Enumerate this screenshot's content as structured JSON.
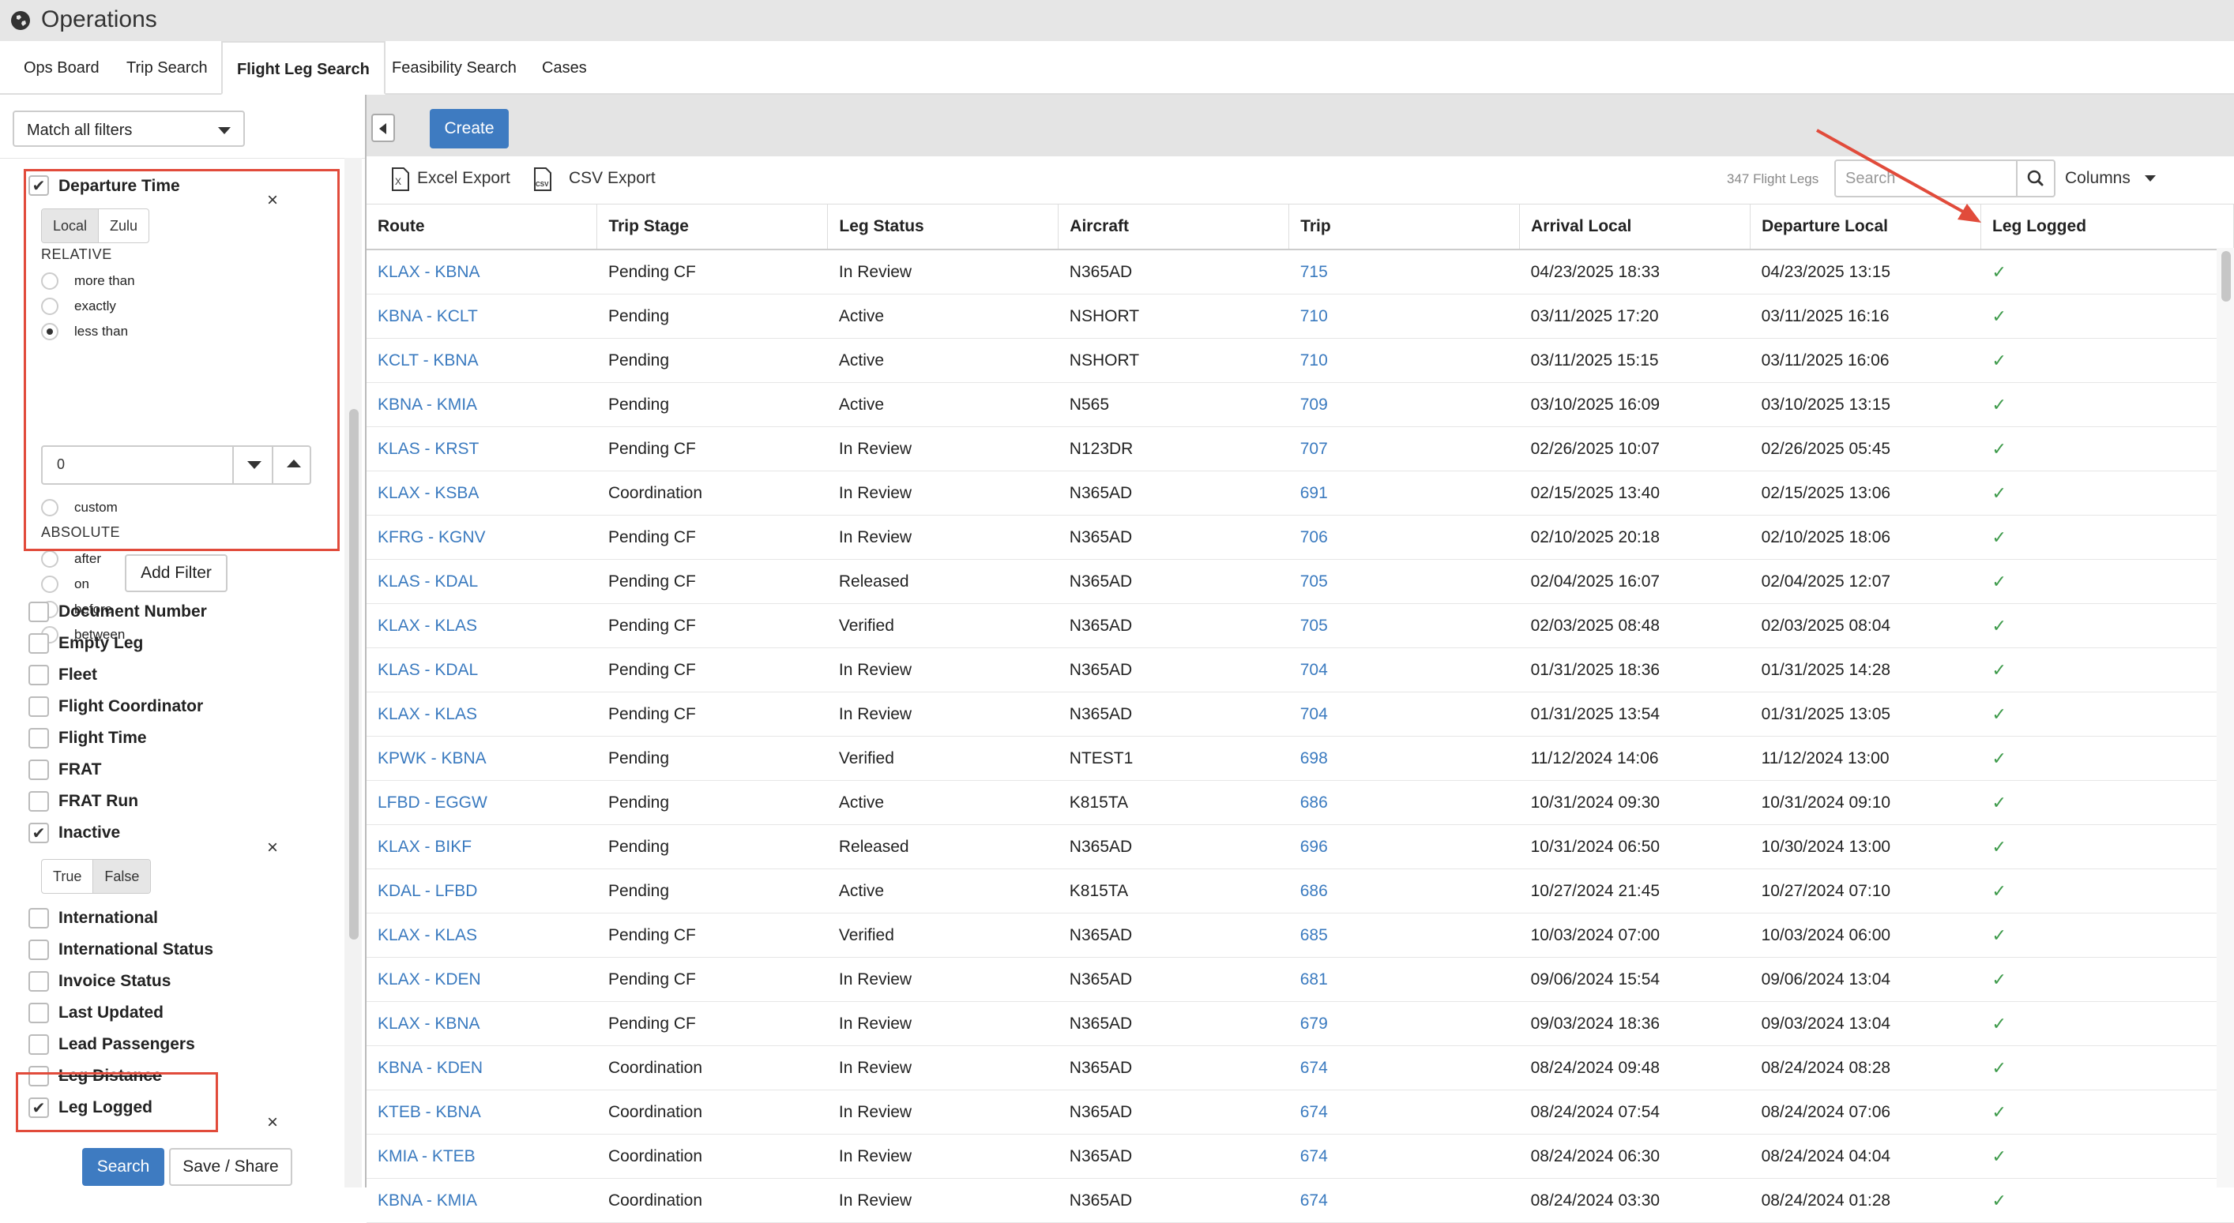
{
  "app": {
    "title": "Operations"
  },
  "tabs": [
    {
      "label": "Ops Board",
      "active": false
    },
    {
      "label": "Trip Search",
      "active": false
    },
    {
      "label": "Flight Leg Search",
      "active": true
    },
    {
      "label": "Feasibility Search",
      "active": false
    },
    {
      "label": "Cases",
      "active": false
    }
  ],
  "filters": {
    "match_mode": "Match all filters",
    "departure_time": {
      "label": "Departure Time",
      "checked": true,
      "timezone_options": [
        "Local",
        "Zulu"
      ],
      "timezone_selected": "Local",
      "relative_heading": "RELATIVE",
      "relative_options": [
        "more than",
        "exactly",
        "less than"
      ],
      "relative_selected": "less than",
      "relative_value": "0",
      "custom_label": "custom",
      "absolute_heading": "ABSOLUTE",
      "absolute_options": [
        "after",
        "on",
        "before",
        "between"
      ]
    },
    "add_filter_label": "Add Filter",
    "items": [
      {
        "label": "Document Number",
        "checked": false
      },
      {
        "label": "Empty Leg",
        "checked": false
      },
      {
        "label": "Fleet",
        "checked": false
      },
      {
        "label": "Flight Coordinator",
        "checked": false
      },
      {
        "label": "Flight Time",
        "checked": false
      },
      {
        "label": "FRAT",
        "checked": false
      },
      {
        "label": "FRAT Run",
        "checked": false
      },
      {
        "label": "Inactive",
        "checked": true
      },
      {
        "label": "International",
        "checked": false
      },
      {
        "label": "International Status",
        "checked": false
      },
      {
        "label": "Invoice Status",
        "checked": false
      },
      {
        "label": "Last Updated",
        "checked": false
      },
      {
        "label": "Lead Passengers",
        "checked": false
      },
      {
        "label": "Leg Distance",
        "checked": false
      },
      {
        "label": "Leg Logged",
        "checked": true
      }
    ],
    "inactive_options": [
      "True",
      "False"
    ],
    "inactive_selected": "False",
    "search_label": "Search",
    "save_share_label": "Save / Share"
  },
  "toolbar": {
    "create_label": "Create",
    "excel_export_label": "Excel Export",
    "csv_export_label": "CSV Export",
    "csv_icon_text": "CSV",
    "excel_icon_text": "X",
    "count_label": "347 Flight Legs",
    "search_placeholder": "Search",
    "columns_label": "Columns"
  },
  "grid": {
    "columns": [
      "Route",
      "Trip Stage",
      "Leg Status",
      "Aircraft",
      "Trip",
      "Arrival Local",
      "Departure Local",
      "Leg Logged"
    ],
    "rows": [
      [
        "KLAX - KBNA",
        "Pending CF",
        "In Review",
        "N365AD",
        "715",
        "04/23/2025 18:33",
        "04/23/2025 13:15",
        "✓"
      ],
      [
        "KBNA - KCLT",
        "Pending",
        "Active",
        "NSHORT",
        "710",
        "03/11/2025 17:20",
        "03/11/2025 16:16",
        "✓"
      ],
      [
        "KCLT - KBNA",
        "Pending",
        "Active",
        "NSHORT",
        "710",
        "03/11/2025 15:15",
        "03/11/2025 16:06",
        "✓"
      ],
      [
        "KBNA - KMIA",
        "Pending",
        "Active",
        "N565",
        "709",
        "03/10/2025 16:09",
        "03/10/2025 13:15",
        "✓"
      ],
      [
        "KLAS - KRST",
        "Pending CF",
        "In Review",
        "N123DR",
        "707",
        "02/26/2025 10:07",
        "02/26/2025 05:45",
        "✓"
      ],
      [
        "KLAX - KSBA",
        "Coordination",
        "In Review",
        "N365AD",
        "691",
        "02/15/2025 13:40",
        "02/15/2025 13:06",
        "✓"
      ],
      [
        "KFRG - KGNV",
        "Pending CF",
        "In Review",
        "N365AD",
        "706",
        "02/10/2025 20:18",
        "02/10/2025 18:06",
        "✓"
      ],
      [
        "KLAS - KDAL",
        "Pending CF",
        "Released",
        "N365AD",
        "705",
        "02/04/2025 16:07",
        "02/04/2025 12:07",
        "✓"
      ],
      [
        "KLAX - KLAS",
        "Pending CF",
        "Verified",
        "N365AD",
        "705",
        "02/03/2025 08:48",
        "02/03/2025 08:04",
        "✓"
      ],
      [
        "KLAS - KDAL",
        "Pending CF",
        "In Review",
        "N365AD",
        "704",
        "01/31/2025 18:36",
        "01/31/2025 14:28",
        "✓"
      ],
      [
        "KLAX - KLAS",
        "Pending CF",
        "In Review",
        "N365AD",
        "704",
        "01/31/2025 13:54",
        "01/31/2025 13:05",
        "✓"
      ],
      [
        "KPWK - KBNA",
        "Pending",
        "Verified",
        "NTEST1",
        "698",
        "11/12/2024 14:06",
        "11/12/2024 13:00",
        "✓"
      ],
      [
        "LFBD - EGGW",
        "Pending",
        "Active",
        "K815TA",
        "686",
        "10/31/2024 09:30",
        "10/31/2024 09:10",
        "✓"
      ],
      [
        "KLAX - BIKF",
        "Pending",
        "Released",
        "N365AD",
        "696",
        "10/31/2024 06:50",
        "10/30/2024 13:00",
        "✓"
      ],
      [
        "KDAL - LFBD",
        "Pending",
        "Active",
        "K815TA",
        "686",
        "10/27/2024 21:45",
        "10/27/2024 07:10",
        "✓"
      ],
      [
        "KLAX - KLAS",
        "Pending CF",
        "Verified",
        "N365AD",
        "685",
        "10/03/2024 07:00",
        "10/03/2024 06:00",
        "✓"
      ],
      [
        "KLAX - KDEN",
        "Pending CF",
        "In Review",
        "N365AD",
        "681",
        "09/06/2024 15:54",
        "09/06/2024 13:04",
        "✓"
      ],
      [
        "KLAX - KBNA",
        "Pending CF",
        "In Review",
        "N365AD",
        "679",
        "09/03/2024 18:36",
        "09/03/2024 13:04",
        "✓"
      ],
      [
        "KBNA - KDEN",
        "Coordination",
        "In Review",
        "N365AD",
        "674",
        "08/24/2024 09:48",
        "08/24/2024 08:28",
        "✓"
      ],
      [
        "KTEB - KBNA",
        "Coordination",
        "In Review",
        "N365AD",
        "674",
        "08/24/2024 07:54",
        "08/24/2024 07:06",
        "✓"
      ],
      [
        "KMIA - KTEB",
        "Coordination",
        "In Review",
        "N365AD",
        "674",
        "08/24/2024 06:30",
        "08/24/2024 04:04",
        "✓"
      ],
      [
        "KBNA - KMIA",
        "Coordination",
        "In Review",
        "N365AD",
        "674",
        "08/24/2024 03:30",
        "08/24/2024 01:28",
        "✓"
      ]
    ]
  },
  "colors": {
    "accent": "#3e7bc1",
    "link": "#3a7abf",
    "check": "#3d9a4a",
    "annotation": "#e14b3b"
  }
}
